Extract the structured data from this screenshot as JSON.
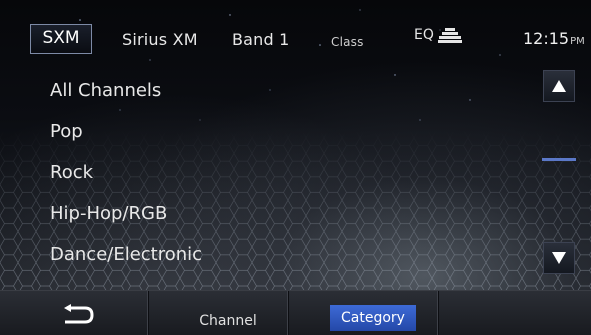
{
  "header": {
    "source_button": "SXM",
    "service": "Sirius XM",
    "band": "Band 1",
    "category": "Class",
    "eq_label": "EQ",
    "eq_icon": "equalizer-icon",
    "time": "12:15",
    "ampm": "PM"
  },
  "list": {
    "items": [
      "All Channels",
      "Pop",
      "Rock",
      "Hip-Hop/RGB",
      "Dance/Electronic"
    ]
  },
  "scroll": {
    "up_icon": "triangle-up-icon",
    "down_icon": "triangle-down-icon"
  },
  "footer": {
    "back_icon": "return-arrow-icon",
    "tab_channel": "Channel",
    "tab_category": "Category",
    "active_tab": "Category",
    "accent_color": "#3d6ad6"
  }
}
